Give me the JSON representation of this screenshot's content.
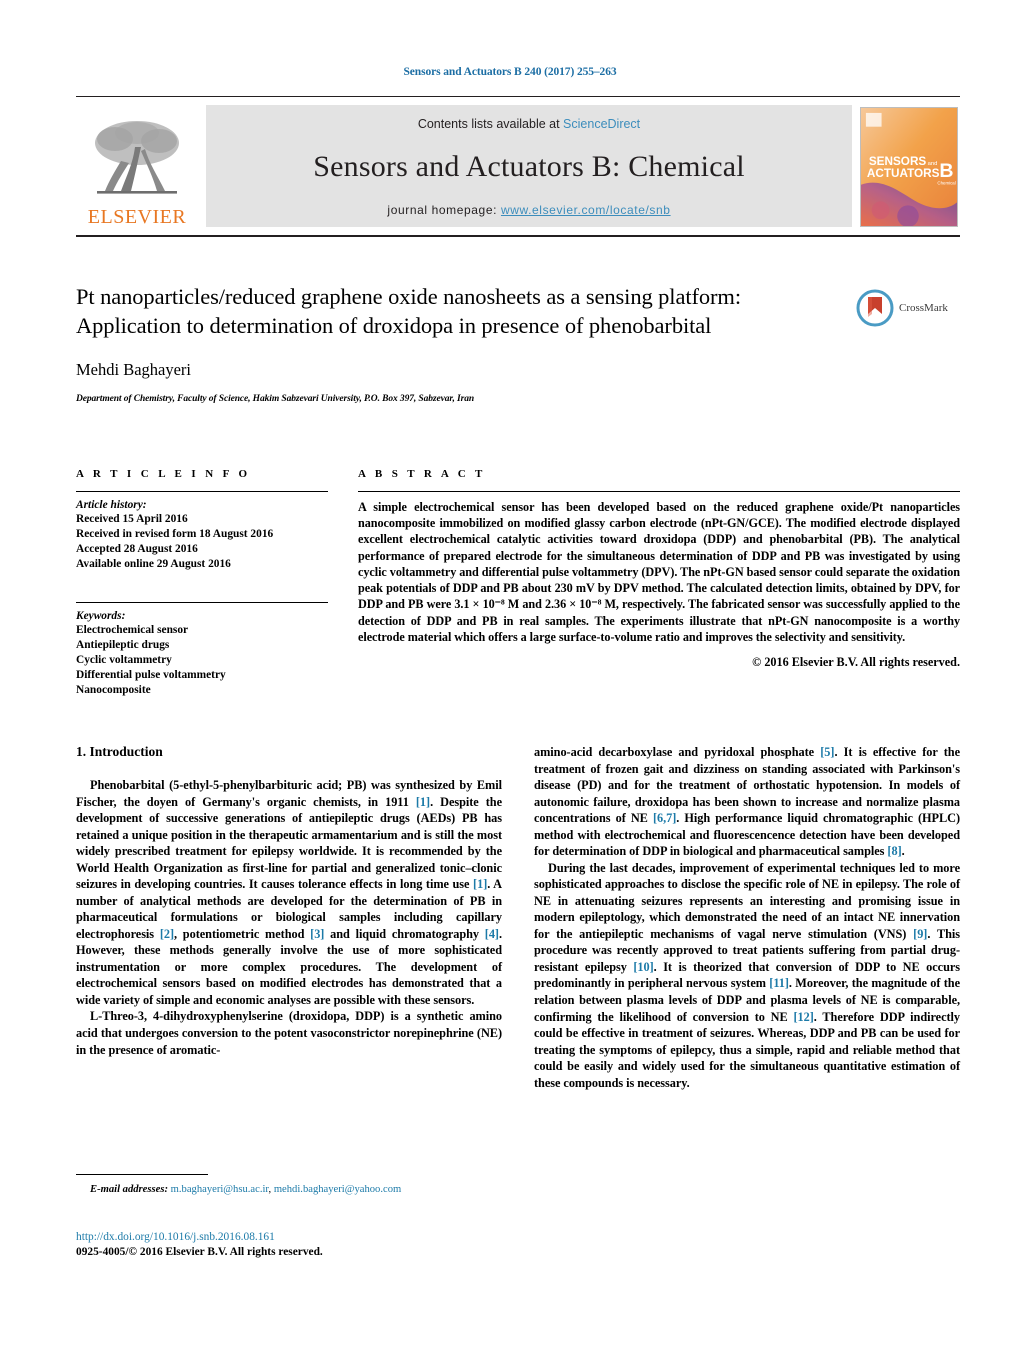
{
  "running_head": "Sensors and Actuators B 240 (2017) 255–263",
  "masthead": {
    "contents_prefix": "Contents lists available at ",
    "sciencedirect": "ScienceDirect",
    "journal_title": "Sensors and Actuators B: Chemical",
    "homepage_prefix": "journal homepage: ",
    "homepage_url": "www.elsevier.com/locate/snb",
    "publisher_logo_text": "ELSEVIER",
    "cover_line1": "SENSORS",
    "cover_and": "and",
    "cover_line2": "ACTUATORS",
    "cover_letter": "B",
    "cover_sub": "Chemical"
  },
  "article": {
    "title": "Pt nanoparticles/reduced graphene oxide nanosheets as a sensing platform: Application to determination of droxidopa in presence of phenobarbital",
    "authors": "Mehdi Baghayeri",
    "affiliation": "Department of Chemistry, Faculty of Science, Hakim Sabzevari University, P.O. Box 397, Sabzevar, Iran",
    "crossmark_label": "CrossMark"
  },
  "article_info": {
    "heading": "A R T I C L E   I N F O",
    "history_label": "Article history:",
    "history": [
      "Received 15 April 2016",
      "Received in revised form 18 August 2016",
      "Accepted 28 August 2016",
      "Available online 29 August 2016"
    ],
    "keywords_label": "Keywords:",
    "keywords": [
      "Electrochemical sensor",
      "Antiepileptic drugs",
      "Cyclic voltammetry",
      "Differential pulse voltammetry",
      "Nanocomposite"
    ]
  },
  "abstract": {
    "heading": "A B S T R A C T",
    "text": "A simple electrochemical sensor has been developed based on the reduced graphene oxide/Pt nanoparticles nanocomposite immobilized on modified glassy carbon electrode (nPt-GN/GCE). The modified electrode displayed excellent electrochemical catalytic activities toward droxidopa (DDP) and phenobarbital (PB). The analytical performance of prepared electrode for the simultaneous determination of DDP and PB was investigated by using cyclic voltammetry and differential pulse voltammetry (DPV). The nPt-GN based sensor could separate the oxidation peak potentials of DDP and PB about 230 mV by DPV method. The calculated detection limits, obtained by DPV, for DDP and PB were 3.1 × 10⁻⁸ M and 2.36 × 10⁻⁸ M, respectively. The fabricated sensor was successfully applied to the detection of DDP and PB in real samples. The experiments illustrate that nPt-GN nanocomposite is a worthy electrode material which offers a large surface-to-volume ratio and improves the selectivity and sensitivity.",
    "copyright": "© 2016 Elsevier B.V. All rights reserved."
  },
  "introduction": {
    "section_number_title": "1.  Introduction",
    "left_paragraphs": [
      "Phenobarbital (5-ethyl-5-phenylbarbituric acid; PB) was synthesized by Emil Fischer, the doyen of Germany's organic chemists, in 1911 [1]. Despite the development of successive generations of antiepileptic drugs (AEDs) PB has retained a unique position in the therapeutic armamentarium and is still the most widely prescribed treatment for epilepsy worldwide. It is recommended by the World Health Organization as first-line for partial and generalized tonic–clonic seizures in developing countries. It causes tolerance effects in long time use [1]. A number of analytical methods are developed for the determination of PB in pharmaceutical formulations or biological samples including capillary electrophoresis [2], potentiometric method [3] and liquid chromatography [4]. However, these methods generally involve the use of more sophisticated instrumentation or more complex procedures. The development of electrochemical sensors based on modified electrodes has demonstrated that a wide variety of simple and economic analyses are possible with these sensors.",
      "L-Threo-3, 4-dihydroxyphenylserine (droxidopa, DDP) is a synthetic amino acid that undergoes conversion to the potent vasoconstrictor norepinephrine (NE) in the presence of aromatic-"
    ],
    "right_paragraphs": [
      "amino-acid decarboxylase and pyridoxal phosphate [5]. It is effective for the treatment of frozen gait and dizziness on standing associated with Parkinson's disease (PD) and for the treatment of orthostatic hypotension. In models of autonomic failure, droxidopa has been shown to increase and normalize plasma concentrations of NE [6,7]. High performance liquid chromatographic (HPLC) method with electrochemical and fluorescencence detection have been developed for determination of DDP in biological and pharmaceutical samples [8].",
      "During the last decades, improvement of experimental techniques led to more sophisticated approaches to disclose the specific role of NE in epilepsy. The role of NE in attenuating seizures represents an interesting and promising issue in modern epileptology, which demonstrated the need of an intact NE innervation for the antiepileptic mechanisms of vagal nerve stimulation (VNS) [9]. This procedure was recently approved to treat patients suffering from partial drug-resistant epilepsy [10]. It is theorized that conversion of DDP to NE occurs predominantly in peripheral nervous system [11]. Moreover, the magnitude of the relation between plasma levels of DDP and plasma levels of NE is comparable, confirming the likelihood of conversion to NE [12]. Therefore DDP indirectly could be effective in treatment of seizures. Whereas, DDP and PB can be used for treating the symptoms of epilepcy, thus a simple, rapid and reliable method that could be easily and widely used for the simultaneous quantitative estimation of these compounds is necessary."
    ]
  },
  "footer": {
    "email_label": "E-mail addresses:",
    "email1": "m.baghayeri@hsu.ac.ir",
    "email_sep": ", ",
    "email2": "mehdi.baghayeri@yahoo.com",
    "doi": "http://dx.doi.org/10.1016/j.snb.2016.08.161",
    "issn": "0925-4005/© 2016 Elsevier B.V. All rights reserved."
  },
  "colors": {
    "link_blue": "#1c7aa8",
    "sciencedirect_blue": "#3c8dbc",
    "elsevier_orange": "#e87722",
    "band_gray": "#e3e3e3"
  }
}
